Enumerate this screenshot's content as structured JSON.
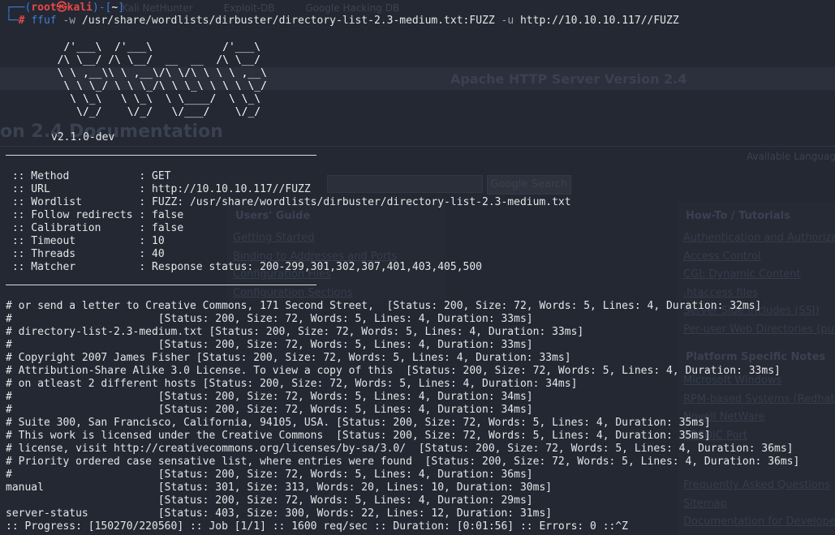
{
  "browser_bg": {
    "tabs": [
      "Kali NetHunter",
      "Exploit-DB",
      "Google Hacking DB"
    ],
    "band_title": "Apache HTTP Server Version 2.4",
    "doc_title": "on 2.4 Documentation",
    "available_languages": "Available Languag",
    "search_button": "Google Search",
    "left_heading": "Users' Guide",
    "left_links": [
      "Getting Started",
      "Binding to Addresses and Ports",
      "Configuration Files",
      "Configuration Sections"
    ],
    "right_heading_1": "How-To / Tutorials",
    "right_links_1": [
      "Authentication and Authoriza",
      "Access Control",
      "CGI: Dynamic Content",
      ".htaccess files",
      "Server Side Includes (SSI)",
      "Per-user Web Directories (pub"
    ],
    "right_heading_2": "Platform Specific Notes",
    "right_links_2": [
      "Microsoft Windows",
      "RPM-based Systems (Redhat",
      "Novell NetWare",
      "EBCDIC Port"
    ],
    "right_links_3": [
      "Frequently Asked Questions",
      "Sitemap",
      "Documentation for Developer"
    ]
  },
  "prompt": {
    "corner_top": "┌──(",
    "user_host": "root㉿kali",
    "mid": ")-[",
    "dir": "~",
    "end": "]",
    "corner_bottom": "└─",
    "hash": "#",
    "cmd_name": "ffuf",
    "flag_w": "-w",
    "wordlist_arg": "/usr/share/wordlists/dirbuster/directory-list-2.3-medium.txt:FUZZ",
    "flag_u": "-u",
    "url_arg": "http://10.10.10.117//FUZZ"
  },
  "logo_lines": [
    "   /'___\\  /'___\\           /'___\\",
    "  /\\ \\__/ /\\ \\__/  __  __  /\\ \\__/",
    "  \\ \\ ,__\\\\ \\ ,__\\/\\ \\/\\ \\ \\ \\ ,__\\",
    "   \\ \\ \\_/ \\ \\ \\_/\\ \\ \\_\\ \\ \\ \\ \\_/",
    "    \\ \\_\\   \\ \\_\\  \\ \\____/  \\ \\_\\",
    "     \\/_/    \\/_/   \\/___/    \\/_/"
  ],
  "version": "v2.1.0-dev",
  "config": [
    " :: Method           : GET",
    " :: URL              : http://10.10.10.117//FUZZ",
    " :: Wordlist         : FUZZ: /usr/share/wordlists/dirbuster/directory-list-2.3-medium.txt",
    " :: Follow redirects : false",
    " :: Calibration      : false",
    " :: Timeout          : 10",
    " :: Threads          : 40",
    " :: Matcher          : Response status: 200-299,301,302,307,401,403,405,500"
  ],
  "results": [
    "# or send a letter to Creative Commons, 171 Second Street,  [Status: 200, Size: 72, Words: 5, Lines: 4, Duration: 32ms]",
    "#                       [Status: 200, Size: 72, Words: 5, Lines: 4, Duration: 33ms]",
    "# directory-list-2.3-medium.txt [Status: 200, Size: 72, Words: 5, Lines: 4, Duration: 33ms]",
    "#                       [Status: 200, Size: 72, Words: 5, Lines: 4, Duration: 33ms]",
    "# Copyright 2007 James Fisher [Status: 200, Size: 72, Words: 5, Lines: 4, Duration: 33ms]",
    "# Attribution-Share Alike 3.0 License. To view a copy of this  [Status: 200, Size: 72, Words: 5, Lines: 4, Duration: 33ms]",
    "# on atleast 2 different hosts [Status: 200, Size: 72, Words: 5, Lines: 4, Duration: 34ms]",
    "#                       [Status: 200, Size: 72, Words: 5, Lines: 4, Duration: 34ms]",
    "#                       [Status: 200, Size: 72, Words: 5, Lines: 4, Duration: 34ms]",
    "# Suite 300, San Francisco, California, 94105, USA. [Status: 200, Size: 72, Words: 5, Lines: 4, Duration: 35ms]",
    "# This work is licensed under the Creative Commons  [Status: 200, Size: 72, Words: 5, Lines: 4, Duration: 35ms]",
    "# license, visit http://creativecommons.org/licenses/by-sa/3.0/  [Status: 200, Size: 72, Words: 5, Lines: 4, Duration: 36ms]",
    "# Priority ordered case sensative list, where entries were found  [Status: 200, Size: 72, Words: 5, Lines: 4, Duration: 36ms]",
    "#                       [Status: 200, Size: 72, Words: 5, Lines: 4, Duration: 36ms]",
    "manual                  [Status: 301, Size: 313, Words: 20, Lines: 10, Duration: 30ms]",
    "                        [Status: 200, Size: 72, Words: 5, Lines: 4, Duration: 29ms]",
    "server-status           [Status: 403, Size: 300, Words: 22, Lines: 12, Duration: 31ms]"
  ],
  "progress": ":: Progress: [150270/220560] :: Job [1/1] :: 1600 req/sec :: Duration: [0:01:56] :: Errors: 0 ::^Z",
  "colors": {
    "background": "#232833",
    "prompt_blue": "#3d7fd6",
    "prompt_red": "#e84848",
    "text": "#e6e6e6"
  }
}
